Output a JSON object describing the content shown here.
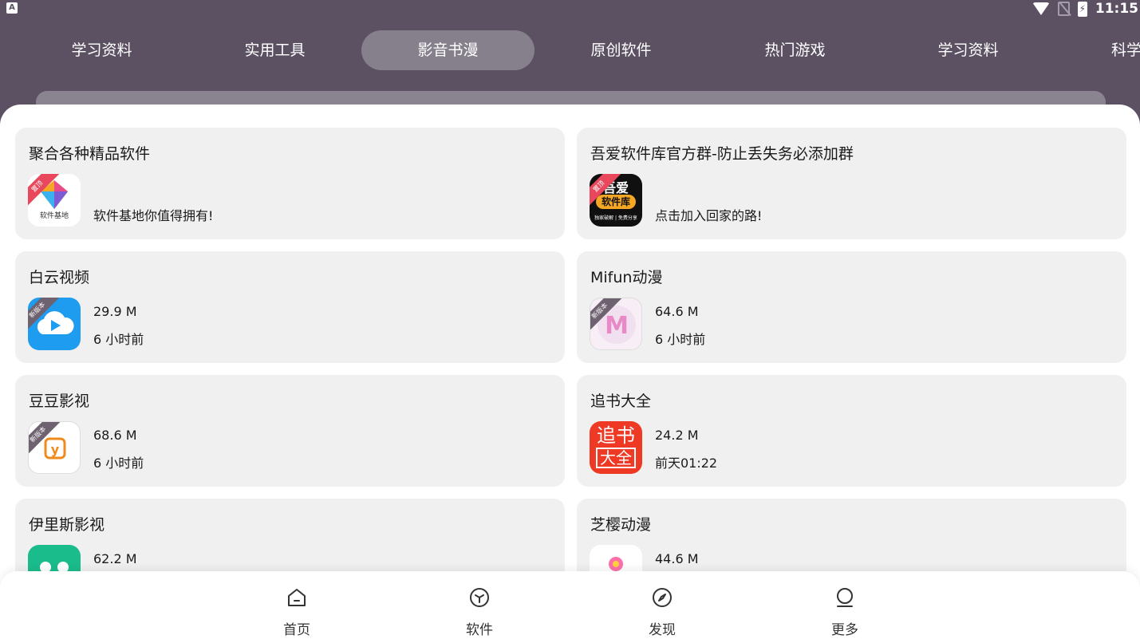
{
  "status_bar": {
    "left_icon": "A",
    "time": "11:15",
    "icons": [
      "wifi-icon",
      "no-sim-icon",
      "battery-charging-icon"
    ]
  },
  "tabs": [
    {
      "label": "学习资料",
      "active": false
    },
    {
      "label": "实用工具",
      "active": false
    },
    {
      "label": "影音书漫",
      "active": true
    },
    {
      "label": "原创软件",
      "active": false
    },
    {
      "label": "热门游戏",
      "active": false
    },
    {
      "label": "学习资料",
      "active": false
    },
    {
      "label": "科学",
      "active": false
    }
  ],
  "cards": [
    {
      "title": "聚合各种精品软件",
      "desc": "软件基地你值得拥有!",
      "icon": "software-base-icon",
      "icon_text": "软件基地",
      "ribbon": "置顶"
    },
    {
      "title": "吾爱软件库官方群-防止丢失务必添加群",
      "desc": "点击加入回家的路!",
      "icon": "wuai-software-icon",
      "icon_text": "吾爱",
      "icon_text2": "软件库",
      "icon_text3": "独家破解 | 免费分享",
      "ribbon": "置顶"
    },
    {
      "title": "白云视频",
      "size": "29.9 M",
      "time": "6 小时前",
      "icon": "baiyun-video-icon",
      "ribbon": "新版本"
    },
    {
      "title": "Mifun动漫",
      "size": "64.6 M",
      "time": "6 小时前",
      "icon": "mifun-anime-icon",
      "ribbon": "新版本"
    },
    {
      "title": "豆豆影视",
      "size": "68.6 M",
      "time": "6 小时前",
      "icon": "doudou-video-icon",
      "ribbon": "新版本"
    },
    {
      "title": "追书大全",
      "size": "24.2 M",
      "time": "前天01:22",
      "icon": "zhuishu-icon",
      "icon_text": "追书",
      "icon_text2": "大全"
    },
    {
      "title": "伊里斯影视",
      "size": "62.2 M",
      "icon": "yilisi-video-icon"
    },
    {
      "title": "芝樱动漫",
      "size": "44.6 M",
      "icon": "zhiying-anime-icon"
    }
  ],
  "bottom_nav": [
    {
      "label": "首页",
      "icon": "home-icon"
    },
    {
      "label": "软件",
      "icon": "cube-icon"
    },
    {
      "label": "发现",
      "icon": "compass-icon"
    },
    {
      "label": "更多",
      "icon": "profile-icon"
    }
  ],
  "colors": {
    "header_bg": "#5b5163",
    "tab_active_bg": "#86808c",
    "card_bg": "#f0f0f0",
    "ribbon_red": "#e8475c",
    "ribbon_gray": "#6e6270"
  }
}
